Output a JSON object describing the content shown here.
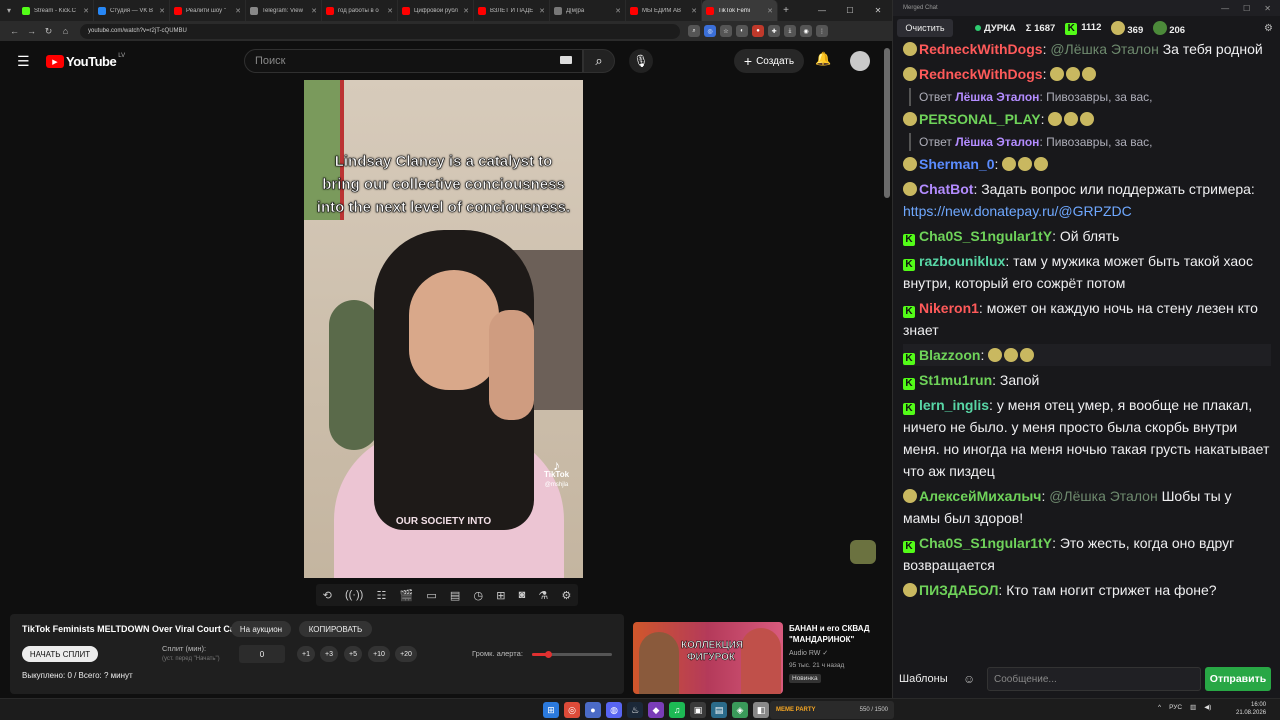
{
  "browser": {
    "tabs": [
      {
        "title": "Stream - Kick.C",
        "fav_color": "#53fc18",
        "active": false
      },
      {
        "title": "Студия — VK В",
        "fav_color": "#2787f5",
        "active": false
      },
      {
        "title": "Реалити шоу \"",
        "fav_color": "#ff0000",
        "active": false
      },
      {
        "title": "Telegram: View",
        "fav_color": "#888888",
        "active": false
      },
      {
        "title": "год работы в о",
        "fav_color": "#ff0000",
        "active": false
      },
      {
        "title": "Цифровой рубл",
        "fav_color": "#ff0000",
        "active": false
      },
      {
        "title": "ВЗЛЕТ И ПАДЕ",
        "fav_color": "#ff0000",
        "active": false
      },
      {
        "title": "Д[м]ра",
        "fav_color": "#777777",
        "active": false
      },
      {
        "title": "МЫ ЕДИМ АВ",
        "fav_color": "#ff0000",
        "active": false
      },
      {
        "title": "TikTok Femi",
        "fav_color": "#ff0000",
        "active": true
      }
    ],
    "url": "youtube.com/watch?v=r2jT-cQUMBU"
  },
  "youtube": {
    "logo_text": "YouTube",
    "country": "LV",
    "search_placeholder": "Поиск",
    "create_label": "Создать"
  },
  "video": {
    "caption": "Lindsay Clancy is a catalyst to bring our collective conciousness into the next level of conciousness.",
    "tiktok_label": "TikTok",
    "tiktok_handle": "@mshjla",
    "subtitle": "OUR SOCIETY INTO"
  },
  "panel": {
    "title": "TikTok Feminists MELTDOWN Over Viral Court Case",
    "auction_label": "На аукцион",
    "copy_label": "КОПИРОВАТЬ",
    "start_label": "НАЧАТЬ СПЛИТ",
    "split_label": "Сплит (мин):",
    "split_hint": "(уст. перед \"Начать\")",
    "split_value": "0",
    "increments": [
      "+1",
      "+3",
      "+5",
      "+10",
      "+20"
    ],
    "alert_label": "Громк. алерта:",
    "alert_level": 0.2,
    "sold_text": "Выкуплено: 0 / Всего: ? минут"
  },
  "recommended": {
    "title": "БАНАН и его СКВАД \"МАНДАРИНОК\"",
    "channel": "Audio RW ✓",
    "meta": "95 тыс.  21 ч назад",
    "badge": "Новинка",
    "thumb_text": "КОЛЛЕКЦИЯ ФИГУРОК"
  },
  "chat": {
    "window_title": "Merged Chat",
    "clear_label": "Очистить",
    "streamer": "ДУРКА",
    "total": "Σ 1687",
    "kick_count": "1112",
    "other_count": "369",
    "third_count": "206",
    "input_placeholder": "Сообщение...",
    "templates_label": "Шаблоны",
    "send_label": "Отправить",
    "messages": [
      {
        "user": "RedneckWithDogs",
        "color": "#ff5a5a",
        "platform": "emote",
        "mention": "@Лёшка Эталон",
        "text": "За тебя родной",
        "reply": null
      },
      {
        "user": "RedneckWithDogs",
        "color": "#ff5a5a",
        "platform": "emote",
        "mention": "",
        "text": "",
        "reply": null
      },
      {
        "user": "PERSONAL_PLAY",
        "color": "#6fd35a",
        "platform": "emote",
        "mention": "",
        "text": "",
        "reply": {
          "prefix": "Ответ",
          "name": "Лёшка Эталон",
          "text": ": Пивозавры, за вас,"
        }
      },
      {
        "user": "Sherman_0",
        "color": "#5b8cff",
        "platform": "emote",
        "mention": "",
        "text": "",
        "reply": {
          "prefix": "Ответ",
          "name": "Лёшка Эталон",
          "text": ": Пивозавры, за вас,"
        }
      },
      {
        "user": "ChatBot",
        "color": "#b38cff",
        "platform": "emote",
        "mention": "",
        "text": "Задать вопрос или поддержать стримера: ",
        "link": "https://new.donatepay.ru/@GRPZDC",
        "reply": null
      },
      {
        "user": "Cha0S_S1ngular1tY",
        "color": "#6fd35a",
        "platform": "kick",
        "mention": "",
        "text": "Ой блять",
        "reply": null
      },
      {
        "user": "razbouniklux",
        "color": "#58d6a6",
        "platform": "kick",
        "mention": "",
        "text": "там у мужика может быть такой хаос внутри, который его сожрёт потом",
        "reply": null
      },
      {
        "user": "Nikeron1",
        "color": "#ff5a5a",
        "platform": "kick",
        "mention": "",
        "text": "может он каждую ночь на стену лезен кто знает",
        "reply": null
      },
      {
        "user": "Blazzoon",
        "color": "#6fd35a",
        "platform": "kick",
        "mention": "",
        "text": "",
        "reply": null
      },
      {
        "user": "St1mu1run",
        "color": "#6fd35a",
        "platform": "kick",
        "mention": "",
        "text": "Запой",
        "reply": null
      },
      {
        "user": "lern_inglis",
        "color": "#58d6a6",
        "platform": "kick",
        "mention": "",
        "text": "у меня отец умер, я вообще не плакал, ничего не было. у меня просто была скорбь внутри меня. но иногда на меня ночью такая грусть накатывает что аж пиздец",
        "reply": null
      },
      {
        "user": "АлексейМихалыч",
        "color": "#6fd35a",
        "platform": "emote",
        "mention": "@Лёшка Эталон",
        "text": "Шобы ты у мамы был здоров!",
        "reply": null
      },
      {
        "user": "Cha0S_S1ngular1tY",
        "color": "#6fd35a",
        "platform": "kick",
        "mention": "",
        "text": "Это жесть, когда оно вдруг возвращается",
        "reply": null
      },
      {
        "user": "ПИЗДАБОЛ",
        "color": "#6fd35a",
        "platform": "emote",
        "mention": "",
        "text": "Кто там ногит стрижет на фоне?",
        "reply": null
      }
    ]
  },
  "taskbar": {
    "meme_label": "MEME PARTY",
    "meme_progress": "550 / 1500",
    "lang": "РУС",
    "time": "16:00",
    "date": "21.08.2026"
  }
}
